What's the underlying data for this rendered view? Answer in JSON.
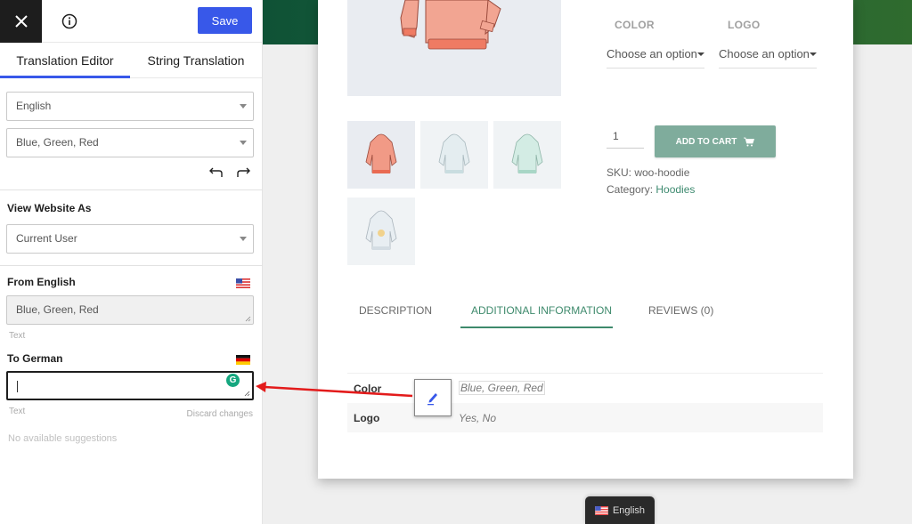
{
  "editor": {
    "save_label": "Save",
    "tabs": [
      {
        "label": "Translation Editor",
        "active": true
      },
      {
        "label": "String Translation",
        "active": false
      }
    ],
    "language_select": "English",
    "string_select": "Blue, Green, Red",
    "view_as": {
      "label": "View Website As",
      "value": "Current User"
    },
    "from": {
      "label": "From English",
      "value": "Blue, Green, Red",
      "type": "Text"
    },
    "to": {
      "label": "To German",
      "value": "",
      "type": "Text",
      "discard_label": "Discard changes"
    },
    "suggestions": "No available suggestions",
    "accent_color": "#3858e9"
  },
  "product": {
    "attributes": [
      {
        "label": "COLOR",
        "placeholder": "Choose an option"
      },
      {
        "label": "LOGO",
        "placeholder": "Choose an option"
      }
    ],
    "quantity": "1",
    "add_to_cart": "ADD TO CART",
    "sku": "SKU: woo-hoodie",
    "category_prefix": "Category: ",
    "category": "Hoodies",
    "tabs": [
      {
        "label": "DESCRIPTION",
        "active": false
      },
      {
        "label": "ADDITIONAL INFORMATION",
        "active": true
      },
      {
        "label": "REVIEWS (0)",
        "active": false
      }
    ],
    "info": [
      {
        "key": "Color",
        "value": "Blue, Green, Red"
      },
      {
        "key": "Logo",
        "value": "Yes, No"
      }
    ],
    "thumbnails": [
      "red-hoodie",
      "blue-hoodie",
      "green-hoodie",
      "logo-hoodie"
    ],
    "accent_color": "#3e8a6c"
  },
  "language_switcher": {
    "label": "English"
  }
}
